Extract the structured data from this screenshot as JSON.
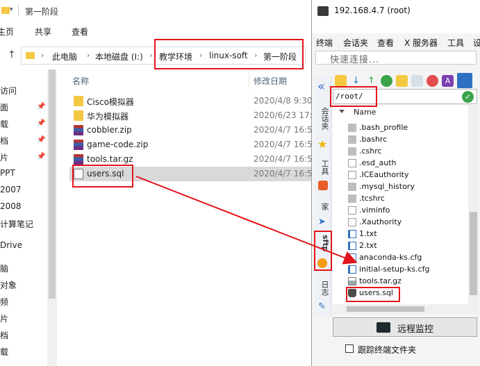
{
  "explorer": {
    "window_title": "第一阶段",
    "ribbon": [
      "主页",
      "共享",
      "查看"
    ],
    "breadcrumbs": [
      "此电脑",
      "本地磁盘 (I:)",
      "教学环境",
      "linux-soft",
      "第一阶段"
    ],
    "nav_items": [
      "访问",
      "面",
      "载",
      "档",
      "片",
      "PPT",
      "2007",
      "2008",
      "计算笔记",
      "Drive",
      "脑",
      "对象",
      "频",
      "片",
      "档",
      "载"
    ],
    "columns": {
      "name": "名称",
      "date": "修改日期"
    },
    "files": [
      {
        "name": "Cisco模拟器",
        "date": "2020/4/8 9:30",
        "kind": "folder"
      },
      {
        "name": "华为模拟器",
        "date": "2020/6/23 17:53",
        "kind": "folder"
      },
      {
        "name": "cobbler.zip",
        "date": "2020/4/7 16:53",
        "kind": "archive"
      },
      {
        "name": "game-code.zip",
        "date": "2020/4/7 16:53",
        "kind": "archive"
      },
      {
        "name": "tools.tar.gz",
        "date": "2020/4/7 16:53",
        "kind": "archive"
      },
      {
        "name": "users.sql",
        "date": "2020/4/7 16:53",
        "kind": "doc",
        "selected": true
      }
    ]
  },
  "xshell": {
    "title": "192.168.4.7 (root)",
    "menu": [
      "终端",
      "会话夹",
      "查看",
      "X 服务器",
      "工具",
      "设"
    ],
    "quick_connect": "快速连接...",
    "side_tabs": [
      "会话夹",
      "工具",
      "家",
      "sftp",
      "日志"
    ],
    "path": "/root/",
    "tree_header": "Name",
    "tree_items": [
      {
        "name": ".bash_profile",
        "icon": "gray"
      },
      {
        "name": ".bashrc",
        "icon": "gray"
      },
      {
        "name": ".cshrc",
        "icon": "gray"
      },
      {
        "name": ".esd_auth",
        "icon": "white"
      },
      {
        "name": ".ICEauthority",
        "icon": "white"
      },
      {
        "name": ".mysql_history",
        "icon": "gray"
      },
      {
        "name": ".tcshrc",
        "icon": "gray"
      },
      {
        "name": ".viminfo",
        "icon": "white"
      },
      {
        "name": ".Xauthority",
        "icon": "white"
      },
      {
        "name": "1.txt",
        "icon": "blue"
      },
      {
        "name": "2.txt",
        "icon": "blue"
      },
      {
        "name": "anaconda-ks.cfg",
        "icon": "blue"
      },
      {
        "name": "initial-setup-ks.cfg",
        "icon": "blue"
      },
      {
        "name": "tools.tar.gz",
        "icon": "tar"
      },
      {
        "name": "users.sql",
        "icon": "db"
      }
    ],
    "monitor_button": "远程监控",
    "follow_label": "跟踪终端文件夹"
  },
  "colors": {
    "highlight": "#e3141b",
    "selection": "#d9d9d9",
    "accent": "#2f6fc2"
  }
}
